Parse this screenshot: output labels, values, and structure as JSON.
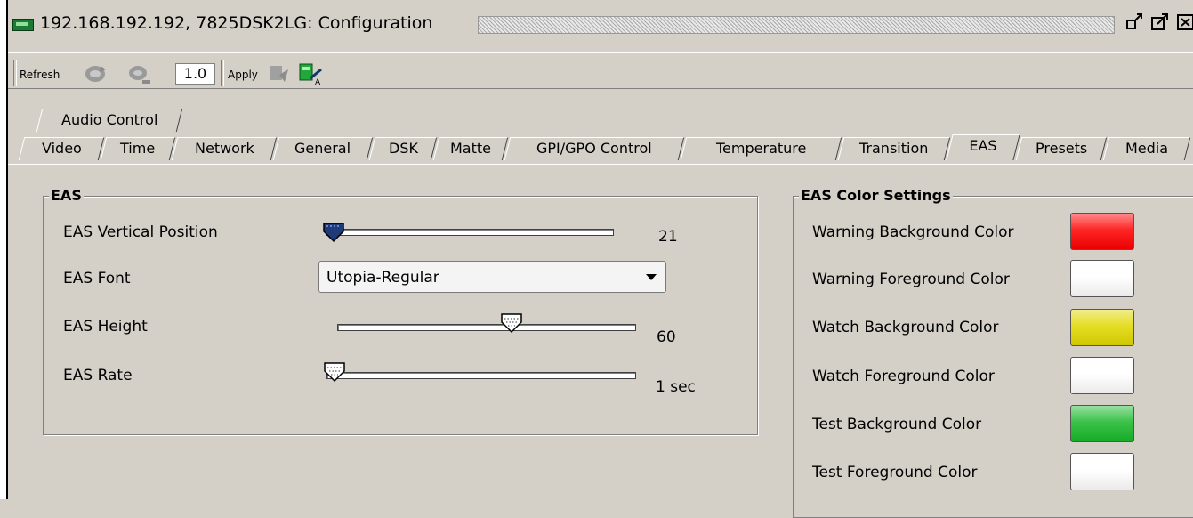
{
  "window": {
    "title": "192.168.192.192, 7825DSK2LG: Configuration"
  },
  "toolbar": {
    "refresh_label": "Refresh",
    "version_value": "1.0",
    "apply_label": "Apply"
  },
  "tabs_row1": [
    {
      "label": "Audio Control"
    }
  ],
  "tabs_row2": [
    {
      "label": "Video"
    },
    {
      "label": "Time"
    },
    {
      "label": "Network"
    },
    {
      "label": "General"
    },
    {
      "label": "DSK"
    },
    {
      "label": "Matte"
    },
    {
      "label": "GPI/GPO Control"
    },
    {
      "label": "Temperature"
    },
    {
      "label": "Transition"
    },
    {
      "label": "EAS"
    },
    {
      "label": "Presets"
    },
    {
      "label": "Media"
    }
  ],
  "active_tab": "EAS",
  "eas": {
    "title": "EAS",
    "vertical_position": {
      "label": "EAS Vertical Position",
      "value": "21",
      "level": 0.0
    },
    "font": {
      "label": "EAS Font",
      "selected": "Utopia-Regular"
    },
    "height": {
      "label": "EAS Height",
      "value": "60",
      "level": 0.58
    },
    "rate": {
      "label": "EAS Rate",
      "value": "1 sec",
      "level": 0.0
    }
  },
  "colors": {
    "title": "EAS Color Settings",
    "items": [
      {
        "label": "Warning Background Color",
        "color": "#ff0000"
      },
      {
        "label": "Warning Foreground Color",
        "color": "#ffffff"
      },
      {
        "label": "Watch Background Color",
        "color": "#e0d800"
      },
      {
        "label": "Watch Foreground Color",
        "color": "#ffffff"
      },
      {
        "label": "Test Background Color",
        "color": "#19b82a"
      },
      {
        "label": "Test Foreground Color",
        "color": "#ffffff"
      }
    ]
  }
}
